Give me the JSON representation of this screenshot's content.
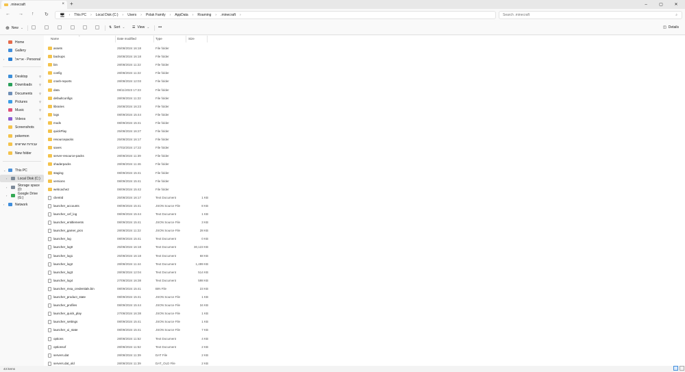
{
  "window": {
    "tab_title": ".minecraft",
    "tab_close": "×",
    "new_tab": "+",
    "controls": [
      "–",
      "▢",
      "✕"
    ]
  },
  "nav": {
    "back": "←",
    "forward": "→",
    "up": "↑",
    "refresh": "↻",
    "monitor": "🖥",
    "expand": "›"
  },
  "address": {
    "crumbs": [
      "This PC",
      "Local Disk (C:)",
      "Users",
      "Polak Family",
      "AppData",
      "Roaming",
      ".minecraft"
    ],
    "separator": "›"
  },
  "search": {
    "placeholder": "Search .minecraft",
    "icon": "⌕"
  },
  "toolbar": {
    "new_label": "New",
    "sort_label": "Sort",
    "view_label": "View",
    "more_label": "•••",
    "details_label": "Details"
  },
  "sidebar": {
    "items": [
      {
        "label": "Home",
        "icon": "home-icon"
      },
      {
        "label": "Gallery",
        "icon": "gallery-icon"
      },
      {
        "label": "אריאל - Personal",
        "icon": "cloud-icon"
      },
      {
        "label": "Desktop",
        "icon": "desktop-icon"
      },
      {
        "label": "Downloads",
        "icon": "downloads-icon"
      },
      {
        "label": "Documents",
        "icon": "documents-icon"
      },
      {
        "label": "Pictures",
        "icon": "pictures-icon"
      },
      {
        "label": "Music",
        "icon": "music-icon"
      },
      {
        "label": "Videos",
        "icon": "videos-icon"
      },
      {
        "label": "Screenshots",
        "icon": "folder-icon"
      },
      {
        "label": "pokemon",
        "icon": "folder-icon"
      },
      {
        "label": "עבודות שורשים",
        "icon": "folder-icon"
      },
      {
        "label": "New folder",
        "icon": "folder-icon"
      },
      {
        "label": "This PC",
        "icon": "pc-icon"
      },
      {
        "label": "Local Disk (C:)",
        "icon": "drive-icon"
      },
      {
        "label": "Storage space (D:",
        "icon": "drive-icon"
      },
      {
        "label": "Google Drive (G:)",
        "icon": "drive-icon"
      },
      {
        "label": "Network",
        "icon": "network-icon"
      }
    ]
  },
  "columns": {
    "name": "Name",
    "date": "Date modified",
    "type": "Type",
    "size": "Size"
  },
  "files": [
    {
      "name": "assets",
      "date": "25/08/2024 16:18",
      "type": "File folder",
      "size": "",
      "kind": "folder"
    },
    {
      "name": "backups",
      "date": "25/08/2024 16:18",
      "type": "File folder",
      "size": "",
      "kind": "folder"
    },
    {
      "name": "bin",
      "date": "28/08/2024 11:22",
      "type": "File folder",
      "size": "",
      "kind": "folder"
    },
    {
      "name": "config",
      "date": "28/08/2024 11:22",
      "type": "File folder",
      "size": "",
      "kind": "folder"
    },
    {
      "name": "crash-reports",
      "date": "28/08/2024 12:03",
      "type": "File folder",
      "size": "",
      "kind": "folder"
    },
    {
      "name": "data",
      "date": "08/11/2023 17:23",
      "type": "File folder",
      "size": "",
      "kind": "folder"
    },
    {
      "name": "defaultconfigs",
      "date": "28/08/2024 11:22",
      "type": "File folder",
      "size": "",
      "kind": "folder"
    },
    {
      "name": "libraries",
      "date": "25/08/2024 16:23",
      "type": "File folder",
      "size": "",
      "kind": "folder"
    },
    {
      "name": "logs",
      "date": "08/09/2024 15:44",
      "type": "File folder",
      "size": "",
      "kind": "folder"
    },
    {
      "name": "mods",
      "date": "08/09/2024 15:41",
      "type": "File folder",
      "size": "",
      "kind": "folder"
    },
    {
      "name": "quickPlay",
      "date": "25/08/2024 16:27",
      "type": "File folder",
      "size": "",
      "kind": "folder"
    },
    {
      "name": "resourcepacks",
      "date": "25/08/2024 16:17",
      "type": "File folder",
      "size": "",
      "kind": "folder"
    },
    {
      "name": "saves",
      "date": "27/02/2024 17:22",
      "type": "File folder",
      "size": "",
      "kind": "folder"
    },
    {
      "name": "server-resource-packs",
      "date": "28/08/2024 11:39",
      "type": "File folder",
      "size": "",
      "kind": "folder"
    },
    {
      "name": "shaderpacks",
      "date": "28/08/2024 11:46",
      "type": "File folder",
      "size": "",
      "kind": "folder"
    },
    {
      "name": "staging",
      "date": "08/09/2024 15:41",
      "type": "File folder",
      "size": "",
      "kind": "folder"
    },
    {
      "name": "versions",
      "date": "08/09/2024 15:41",
      "type": "File folder",
      "size": "",
      "kind": "folder"
    },
    {
      "name": "webcache2",
      "date": "08/09/2024 15:42",
      "type": "File folder",
      "size": "",
      "kind": "folder"
    },
    {
      "name": "clientId",
      "date": "25/08/2024 16:17",
      "type": "Text Document",
      "size": "1 KB",
      "kind": "file"
    },
    {
      "name": "launcher_accounts",
      "date": "08/09/2024 15:41",
      "type": "JSON Source File",
      "size": "8 KB",
      "kind": "file"
    },
    {
      "name": "launcher_cef_log",
      "date": "08/09/2024 15:44",
      "type": "Text Document",
      "size": "1 KB",
      "kind": "file"
    },
    {
      "name": "launcher_entitlements",
      "date": "08/09/2024 15:41",
      "type": "JSON Source File",
      "size": "3 KB",
      "kind": "file"
    },
    {
      "name": "launcher_gamer_pics",
      "date": "28/08/2024 11:22",
      "type": "JSON Source File",
      "size": "28 KB",
      "kind": "file"
    },
    {
      "name": "launcher_log",
      "date": "08/09/2024 15:41",
      "type": "Text Document",
      "size": "0 KB",
      "kind": "file"
    },
    {
      "name": "launcher_log0",
      "date": "25/08/2024 16:18",
      "type": "Text Document",
      "size": "30,123 KB",
      "kind": "file"
    },
    {
      "name": "launcher_log1",
      "date": "25/08/2024 16:18",
      "type": "Text Document",
      "size": "68 KB",
      "kind": "file"
    },
    {
      "name": "launcher_log2",
      "date": "28/08/2024 11:44",
      "type": "Text Document",
      "size": "1,499 KB",
      "kind": "file"
    },
    {
      "name": "launcher_log3",
      "date": "28/08/2024 12:04",
      "type": "Text Document",
      "size": "514 KB",
      "kind": "file"
    },
    {
      "name": "launcher_log4",
      "date": "27/08/2024 16:38",
      "type": "Text Document",
      "size": "598 KB",
      "kind": "file"
    },
    {
      "name": "launcher_msa_credentials.bin",
      "date": "08/09/2024 15:41",
      "type": "BIN File",
      "size": "23 KB",
      "kind": "file"
    },
    {
      "name": "launcher_product_state",
      "date": "08/09/2024 15:41",
      "type": "JSON Source File",
      "size": "1 KB",
      "kind": "file"
    },
    {
      "name": "launcher_profiles",
      "date": "08/09/2024 15:44",
      "type": "JSON Source File",
      "size": "34 KB",
      "kind": "file"
    },
    {
      "name": "launcher_quick_play",
      "date": "27/08/2024 16:38",
      "type": "JSON Source File",
      "size": "1 KB",
      "kind": "file"
    },
    {
      "name": "launcher_settings",
      "date": "08/09/2024 15:41",
      "type": "JSON Source File",
      "size": "1 KB",
      "kind": "file"
    },
    {
      "name": "launcher_ui_state",
      "date": "08/09/2024 15:41",
      "type": "JSON Source File",
      "size": "7 KB",
      "kind": "file"
    },
    {
      "name": "options",
      "date": "28/08/2024 11:52",
      "type": "Text Document",
      "size": "4 KB",
      "kind": "file"
    },
    {
      "name": "optionsof",
      "date": "28/08/2024 11:52",
      "type": "Text Document",
      "size": "2 KB",
      "kind": "file"
    },
    {
      "name": "servers.dat",
      "date": "28/08/2024 11:39",
      "type": "DAT File",
      "size": "2 KB",
      "kind": "file"
    },
    {
      "name": "servers.dat_old",
      "date": "28/08/2024 11:39",
      "type": "DAT_OLD File",
      "size": "2 KB",
      "kind": "file"
    }
  ],
  "status": {
    "count": "43 items"
  },
  "colors": {
    "folder": "#f4c34b",
    "selected": "#e1e1e1"
  }
}
